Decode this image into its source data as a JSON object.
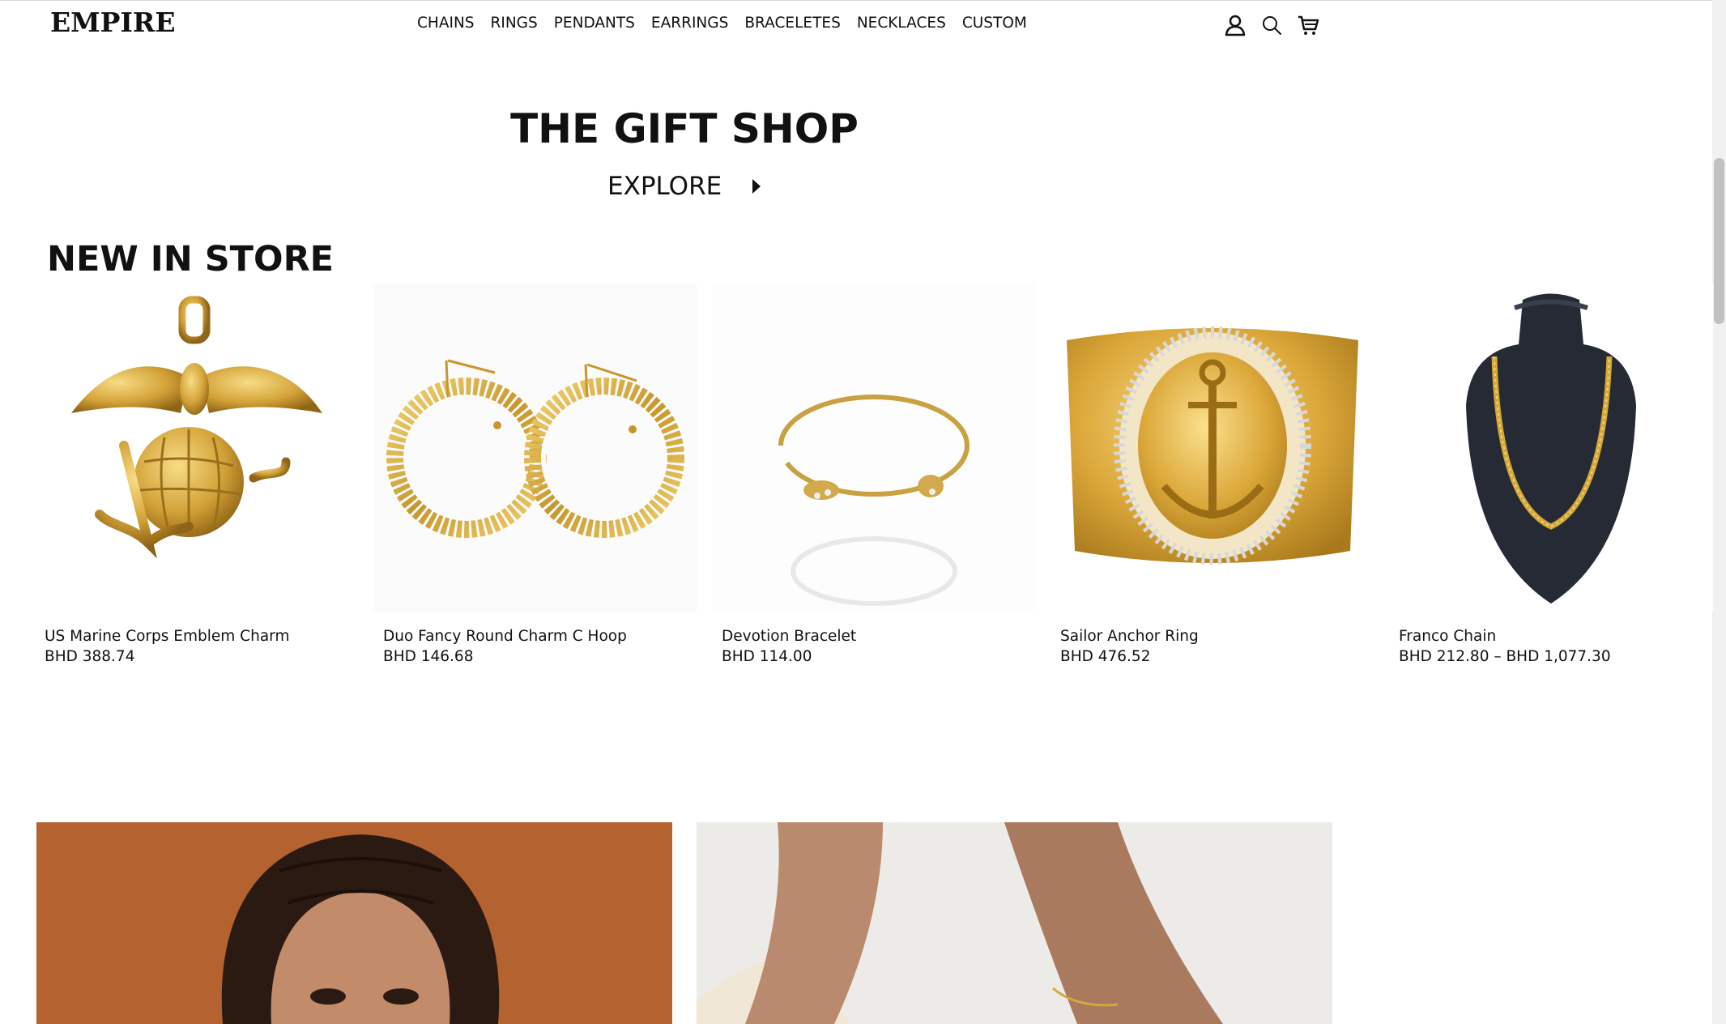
{
  "header": {
    "logo": "EMPIRE",
    "nav": [
      "CHAINS",
      "RINGS",
      "PENDANTS",
      "EARRINGS",
      "BRACELETES",
      "NECKLACES",
      "CUSTOM"
    ],
    "icons": [
      "account-icon",
      "search-icon",
      "cart-icon"
    ]
  },
  "hero": {
    "title": "THE GIFT SHOP",
    "explore_label": "EXPLORE"
  },
  "new_in_store": {
    "title": "NEW IN STORE",
    "products": [
      {
        "name": "US Marine Corps Emblem Charm",
        "price": "BHD 388.74"
      },
      {
        "name": "Duo Fancy Round Charm C Hoop",
        "price": "BHD 146.68"
      },
      {
        "name": "Devotion Bracelet",
        "price": "BHD 114.00"
      },
      {
        "name": "Sailor Anchor Ring",
        "price": "BHD 476.52"
      },
      {
        "name": "Franco Chain",
        "price": "BHD 212.80 – BHD 1,077.30"
      }
    ]
  },
  "colors": {
    "text": "#111111",
    "gold": "#d4a83a",
    "banner_orange": "#b4622f",
    "banner_light": "#ecebe8"
  }
}
